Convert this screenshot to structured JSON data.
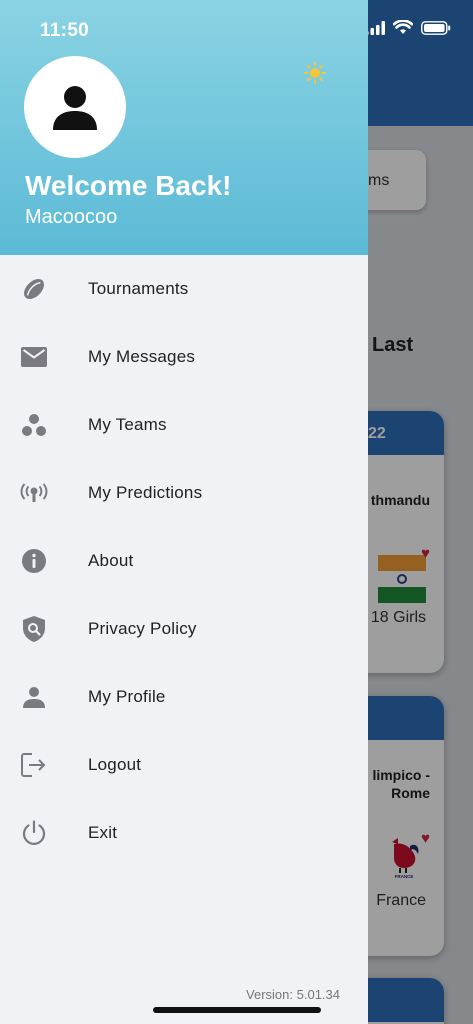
{
  "status_bar": {
    "time": "11:50"
  },
  "header": {
    "welcome": "Welcome Back!",
    "username": "Macoocoo"
  },
  "menu": [
    {
      "label": "Tournaments",
      "icon": "rugby-ball-icon"
    },
    {
      "label": "My Messages",
      "icon": "mail-icon"
    },
    {
      "label": "My Teams",
      "icon": "group-dots-icon"
    },
    {
      "label": "My Predictions",
      "icon": "broadcast-icon"
    },
    {
      "label": "About",
      "icon": "info-icon"
    },
    {
      "label": "Privacy Policy",
      "icon": "shield-search-icon"
    },
    {
      "label": "My Profile",
      "icon": "person-icon"
    },
    {
      "label": "Logout",
      "icon": "logout-icon"
    },
    {
      "label": "Exit",
      "icon": "power-icon"
    }
  ],
  "version": "Version: 5.01.34",
  "background": {
    "pill_text": "ms",
    "heading": "Last",
    "card1": {
      "header": "22",
      "venue": "thmandu",
      "team": "18 Girls"
    },
    "card2": {
      "venue_line1": "limpico -",
      "venue_line2": "Rome",
      "team": "France",
      "logo_text": "FRANCE RUGBY"
    }
  },
  "colors": {
    "header_top": "#8ad3e3",
    "header_bottom": "#5cbad6",
    "drawer_bg": "#f0f2f6",
    "icon_gray": "#7a7a80",
    "app_blue": "#2e6fb9",
    "sun": "#f5c53a"
  }
}
